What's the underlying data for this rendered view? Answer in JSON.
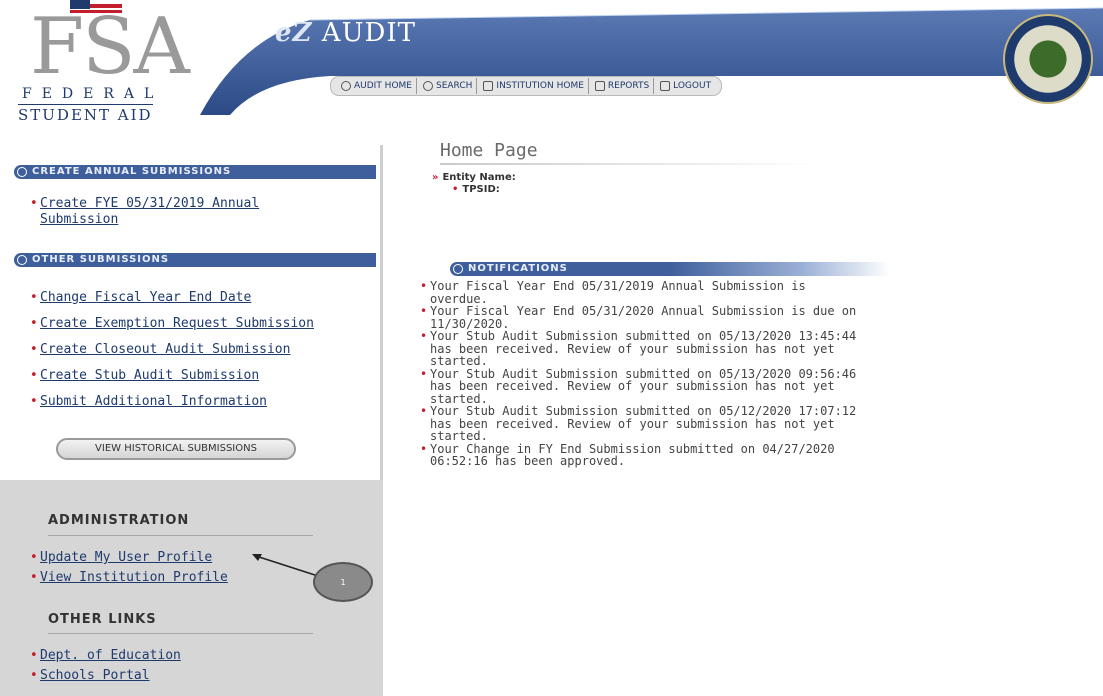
{
  "header": {
    "logo": {
      "big": "FSA",
      "federal": "FEDERAL",
      "student_aid": "STUDENT AID"
    },
    "app_title_ez": "eZ",
    "app_title_rest": "AUDIT",
    "nav": [
      {
        "label": "AUDIT HOME",
        "icon": "audit-home-icon"
      },
      {
        "label": "SEARCH",
        "icon": "search-icon"
      },
      {
        "label": "INSTITUTION HOME",
        "icon": "home-icon"
      },
      {
        "label": "REPORTS",
        "icon": "reports-icon"
      },
      {
        "label": "LOGOUT",
        "icon": "logout-icon"
      }
    ],
    "seal": "department-of-education-seal"
  },
  "sidebar": {
    "create_annual": {
      "title": "CREATE ANNUAL SUBMISSIONS",
      "items": [
        "Create FYE 05/31/2019 Annual Submission"
      ]
    },
    "other": {
      "title": "OTHER SUBMISSIONS",
      "items": [
        "Change Fiscal Year End Date",
        "Create Exemption Request Submission",
        "Create Closeout Audit Submission",
        "Create Stub Audit Submission",
        "Submit Additional Information"
      ],
      "historical_button": "VIEW HISTORICAL SUBMISSIONS"
    },
    "administration": {
      "title": "ADMINISTRATION",
      "items": [
        "Update My User Profile",
        "View Institution Profile"
      ]
    },
    "other_links": {
      "title": "OTHER LINKS",
      "items": [
        "Dept. of Education",
        "Schools Portal"
      ]
    },
    "callout_number": "1"
  },
  "main": {
    "page_title": "Home Page",
    "entity_label": "Entity Name:",
    "tpsid_label": "TPSID:",
    "notifications_title": "NOTIFICATIONS",
    "notifications": [
      "Your Fiscal Year End 05/31/2019 Annual Submission is overdue.",
      "Your Fiscal Year End 05/31/2020 Annual Submission is due on 11/30/2020.",
      "Your Stub Audit Submission submitted on 05/13/2020 13:45:44 has been received. Review of your submission has not yet started.",
      "Your Stub Audit Submission submitted on 05/13/2020 09:56:46 has been received. Review of your submission has not yet started.",
      "Your Stub Audit Submission submitted on 05/12/2020 17:07:12 has been received. Review of your submission has not yet started.",
      "Your Change in FY End Submission submitted on 04/27/2020 06:52:16 has been approved."
    ]
  },
  "colors": {
    "header_blue": "#3f5f9c",
    "link_blue": "#1f3a6d",
    "bullet_red": "#c41e2e",
    "sidebar_gray": "#d6d6d6"
  }
}
